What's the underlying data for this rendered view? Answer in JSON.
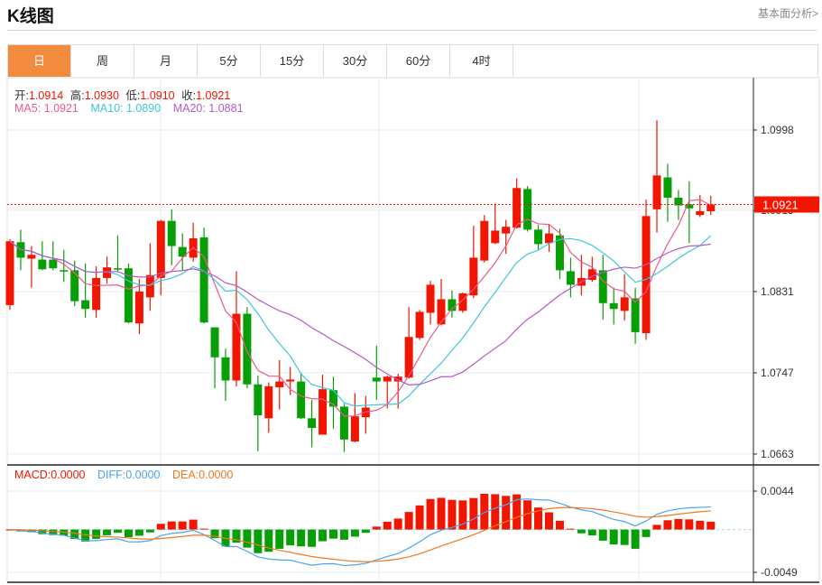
{
  "header": {
    "title": "K线图",
    "link": "基本面分析>"
  },
  "tabs": [
    {
      "label": "日",
      "active": true
    },
    {
      "label": "周"
    },
    {
      "label": "月"
    },
    {
      "label": "5分"
    },
    {
      "label": "15分"
    },
    {
      "label": "30分"
    },
    {
      "label": "60分"
    },
    {
      "label": "4时"
    }
  ],
  "ohlc_legend": {
    "open_label": "开:",
    "open": "1.0914",
    "high_label": "高:",
    "high": "1.0930",
    "low_label": "低:",
    "low": "1.0910",
    "close_label": "收:",
    "close": "1.0921"
  },
  "ma_legend": {
    "ma5": "MA5: 1.0921",
    "ma10": "MA10: 1.0890",
    "ma20": "MA20: 1.0881"
  },
  "macd_legend": {
    "macd": "MACD:0.0000",
    "diff": "DIFF:0.0000",
    "dea": "DEA:0.0000"
  },
  "colors": {
    "up": "#f21500",
    "down": "#06a006",
    "ma5": "#f0588a",
    "ma10": "#3cc7dc",
    "ma20": "#b35ac8",
    "diff": "#4aa3f0",
    "dea": "#f07820",
    "accent": "#f38b3e"
  },
  "chart_data": {
    "type": "candlestick",
    "price_axis": {
      "ticks": [
        "1.0998",
        "1.0915",
        "1.0831",
        "1.0747",
        "1.0663"
      ],
      "range": [
        1.0663,
        1.0998
      ]
    },
    "macd_axis": {
      "ticks": [
        "0.0044",
        "-0.0049"
      ],
      "range": [
        -0.0049,
        0.0044
      ]
    },
    "last_price": "1.0921",
    "candles": [
      [
        1.0817,
        1.0885,
        1.0812,
        1.0883
      ],
      [
        1.0882,
        1.0895,
        1.0853,
        1.0866
      ],
      [
        1.0865,
        1.0878,
        1.0835,
        1.0869
      ],
      [
        1.0864,
        1.0883,
        1.0853,
        1.0854
      ],
      [
        1.0864,
        1.0883,
        1.0853,
        1.0855
      ],
      [
        1.0853,
        1.0874,
        1.0841,
        1.0852
      ],
      [
        1.0853,
        1.0863,
        1.0816,
        1.0821
      ],
      [
        1.0822,
        1.086,
        1.0804,
        1.0813
      ],
      [
        1.0812,
        1.0857,
        1.0804,
        1.0845
      ],
      [
        1.0845,
        1.0867,
        1.0839,
        1.0856
      ],
      [
        1.0855,
        1.0889,
        1.0851,
        1.0854
      ],
      [
        1.0855,
        1.086,
        1.0798,
        1.0799
      ],
      [
        1.0798,
        1.0844,
        1.0787,
        1.0831
      ],
      [
        1.0825,
        1.0881,
        1.0811,
        1.0848
      ],
      [
        1.0845,
        1.0905,
        1.0827,
        1.0904
      ],
      [
        1.0904,
        1.0916,
        1.0858,
        1.0878
      ],
      [
        1.0877,
        1.0891,
        1.0853,
        1.0867
      ],
      [
        1.0866,
        1.0902,
        1.0862,
        1.0886
      ],
      [
        1.0887,
        1.0897,
        1.0798,
        1.0799
      ],
      [
        1.0794,
        1.0794,
        1.0731,
        1.0763
      ],
      [
        1.0763,
        1.0772,
        1.0718,
        1.0739
      ],
      [
        1.0739,
        1.0852,
        1.0733,
        1.0808
      ],
      [
        1.0808,
        1.0815,
        1.0731,
        1.0735
      ],
      [
        1.0735,
        1.0744,
        1.0666,
        1.0703
      ],
      [
        1.07,
        1.0737,
        1.0685,
        1.0733
      ],
      [
        1.0732,
        1.076,
        1.0709,
        1.0738
      ],
      [
        1.0738,
        1.0753,
        1.0724,
        1.074
      ],
      [
        1.0738,
        1.0747,
        1.0699,
        1.07
      ],
      [
        1.07,
        1.0719,
        1.067,
        1.069
      ],
      [
        1.0683,
        1.0745,
        1.0683,
        1.073
      ],
      [
        1.0729,
        1.0743,
        1.0689,
        1.0712
      ],
      [
        1.0712,
        1.0715,
        1.0665,
        1.0678
      ],
      [
        1.0676,
        1.0726,
        1.0675,
        1.0702
      ],
      [
        1.0701,
        1.0723,
        1.0684,
        1.0711
      ],
      [
        1.0742,
        1.0775,
        1.0719,
        1.0738
      ],
      [
        1.0738,
        1.0744,
        1.071,
        1.0743
      ],
      [
        1.0738,
        1.0746,
        1.071,
        1.0743
      ],
      [
        1.0742,
        1.0815,
        1.0741,
        1.0784
      ],
      [
        1.0783,
        1.0812,
        1.0781,
        1.081
      ],
      [
        1.0809,
        1.0842,
        1.0797,
        1.0838
      ],
      [
        1.0797,
        1.0844,
        1.0796,
        1.0823
      ],
      [
        1.0823,
        1.0832,
        1.0804,
        1.0811
      ],
      [
        1.0811,
        1.083,
        1.0809,
        1.0829
      ],
      [
        1.0827,
        1.0899,
        1.0824,
        1.0866
      ],
      [
        1.0863,
        1.091,
        1.0861,
        1.0904
      ],
      [
        1.0881,
        1.0922,
        1.088,
        1.0894
      ],
      [
        1.0891,
        1.0905,
        1.087,
        1.0898
      ],
      [
        1.0897,
        1.0948,
        1.0896,
        1.0938
      ],
      [
        1.0937,
        1.094,
        1.0893,
        1.0895
      ],
      [
        1.0895,
        1.09,
        1.0874,
        1.088
      ],
      [
        1.0881,
        1.0901,
        1.0872,
        1.0891
      ],
      [
        1.0889,
        1.0896,
        1.0844,
        1.0853
      ],
      [
        1.0852,
        1.0866,
        1.0825,
        1.0838
      ],
      [
        1.0837,
        1.0869,
        1.0827,
        1.0845
      ],
      [
        1.0843,
        1.0867,
        1.0841,
        1.0854
      ],
      [
        1.0853,
        1.0869,
        1.0802,
        1.0819
      ],
      [
        1.0819,
        1.0835,
        1.0797,
        1.0813
      ],
      [
        1.0811,
        1.0849,
        1.0801,
        1.0825
      ],
      [
        1.0824,
        1.0835,
        1.0777,
        1.0789
      ],
      [
        1.0788,
        1.0926,
        1.0781,
        1.0909
      ],
      [
        1.0916,
        1.1008,
        1.0892,
        1.0951
      ],
      [
        1.0949,
        1.0963,
        1.0903,
        1.0928
      ],
      [
        1.0928,
        1.0936,
        1.0905,
        1.092
      ],
      [
        1.0921,
        1.0945,
        1.0881,
        1.0917
      ],
      [
        1.091,
        1.0931,
        1.0908,
        1.0914
      ],
      [
        1.0914,
        1.093,
        1.091,
        1.0921
      ]
    ]
  }
}
